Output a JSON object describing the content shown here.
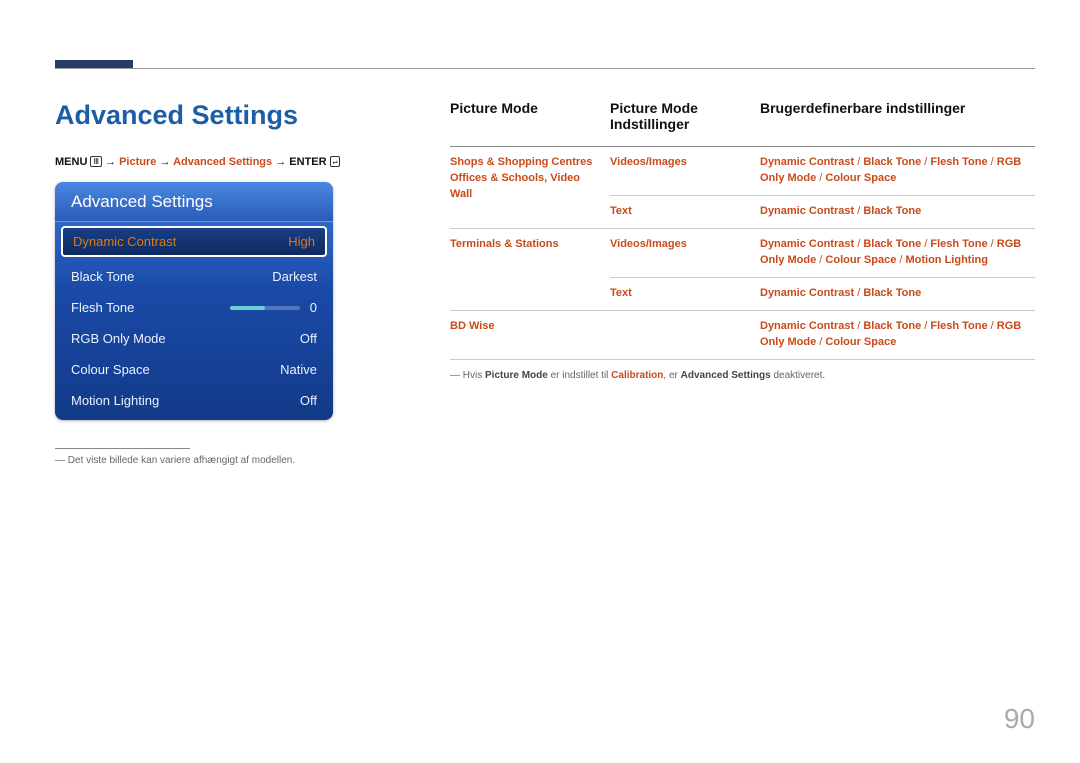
{
  "heading": "Advanced Settings",
  "breadcrumb": {
    "menu": "MENU",
    "arrow": "→",
    "picture": "Picture",
    "advanced": "Advanced Settings",
    "enter": "ENTER"
  },
  "panel": {
    "title": "Advanced Settings",
    "rows": [
      {
        "label": "Dynamic Contrast",
        "value": "High",
        "selected": true,
        "slider": false
      },
      {
        "label": "Black Tone",
        "value": "Darkest",
        "selected": false,
        "slider": false
      },
      {
        "label": "Flesh Tone",
        "value": "0",
        "selected": false,
        "slider": true
      },
      {
        "label": "RGB Only Mode",
        "value": "Off",
        "selected": false,
        "slider": false
      },
      {
        "label": "Colour Space",
        "value": "Native",
        "selected": false,
        "slider": false
      },
      {
        "label": "Motion Lighting",
        "value": "Off",
        "selected": false,
        "slider": false
      }
    ]
  },
  "footnote_prefix": "―",
  "footnote": "Det viste billede kan variere afhængigt af modellen.",
  "table": {
    "headers": {
      "col1": "Picture Mode",
      "col2": "Picture Mode Indstillinger",
      "col3": "Brugerdefinerbare indstillinger"
    },
    "rows": [
      {
        "c1": [
          "Shops & Shopping Centres",
          "Offices & Schools, Video Wall"
        ],
        "c2": "Videos/Images",
        "c3": [
          "Dynamic Contrast",
          "Black Tone",
          "Flesh Tone",
          "RGB Only Mode",
          "Colour Space"
        ]
      },
      {
        "c1": [],
        "c2": "Text",
        "c3": [
          "Dynamic Contrast",
          "Black Tone"
        ]
      },
      {
        "c1": [
          "Terminals & Stations"
        ],
        "c2": "Videos/Images",
        "c3": [
          "Dynamic Contrast",
          "Black Tone",
          "Flesh Tone",
          "RGB Only Mode",
          "Colour Space",
          "Motion Lighting"
        ]
      },
      {
        "c1": [],
        "c2": "Text",
        "c3": [
          "Dynamic Contrast",
          "Black Tone"
        ]
      },
      {
        "c1": [
          "BD Wise"
        ],
        "c2": "",
        "c3": [
          "Dynamic Contrast",
          "Black Tone",
          "Flesh Tone",
          "RGB Only Mode",
          "Colour Space"
        ]
      }
    ],
    "note": {
      "prefix": "―",
      "t1": "Hvis ",
      "t2": "Picture Mode",
      "t3": " er indstillet til ",
      "t4": "Calibration",
      "t5": ", er ",
      "t6": "Advanced Settings",
      "t7": " deaktiveret."
    }
  },
  "page_number": "90"
}
